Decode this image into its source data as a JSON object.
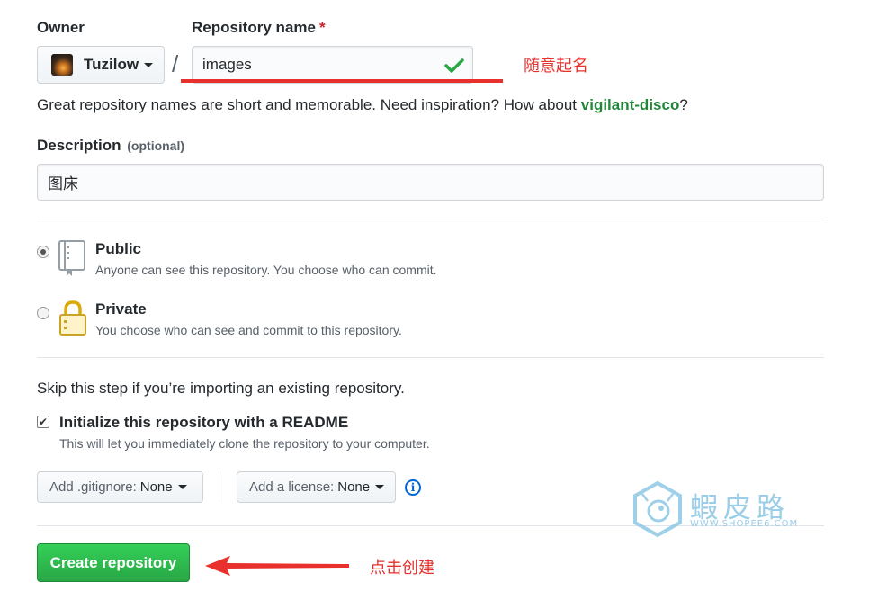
{
  "owner": {
    "label": "Owner",
    "selected": "Tuzilow"
  },
  "separator": "/",
  "repo_name": {
    "label": "Repository name",
    "required_mark": "*",
    "value": "images"
  },
  "hint": {
    "text": "Great repository names are short and memorable. Need inspiration? How about ",
    "suggestion": "vigilant-disco",
    "end": "?"
  },
  "description": {
    "label": "Description",
    "optional": "(optional)",
    "value": "图床"
  },
  "visibility": {
    "public": {
      "title": "Public",
      "desc": "Anyone can see this repository. You choose who can commit.",
      "selected": true
    },
    "private": {
      "title": "Private",
      "desc": "You choose who can see and commit to this repository.",
      "selected": false
    }
  },
  "import_note": "Skip this step if you’re importing an existing repository.",
  "readme": {
    "title": "Initialize this repository with a README",
    "desc": "This will let you immediately clone the repository to your computer.",
    "checked": true,
    "check_glyph": "✔"
  },
  "gitignore": {
    "label": "Add .gitignore: ",
    "value": "None"
  },
  "license": {
    "label": "Add a license: ",
    "value": "None"
  },
  "info_glyph": "i",
  "create_button": "Create repository",
  "annotations": {
    "name_note": "随意起名",
    "create_note": "点击创建",
    "color": "#e8302c"
  },
  "watermark": {
    "title": "蝦皮路",
    "url": "WWW.SHOPEE6.COM"
  },
  "colors": {
    "accent_green": "#28a745",
    "suggestion_green": "#22863a",
    "link_blue": "#0366d6"
  }
}
